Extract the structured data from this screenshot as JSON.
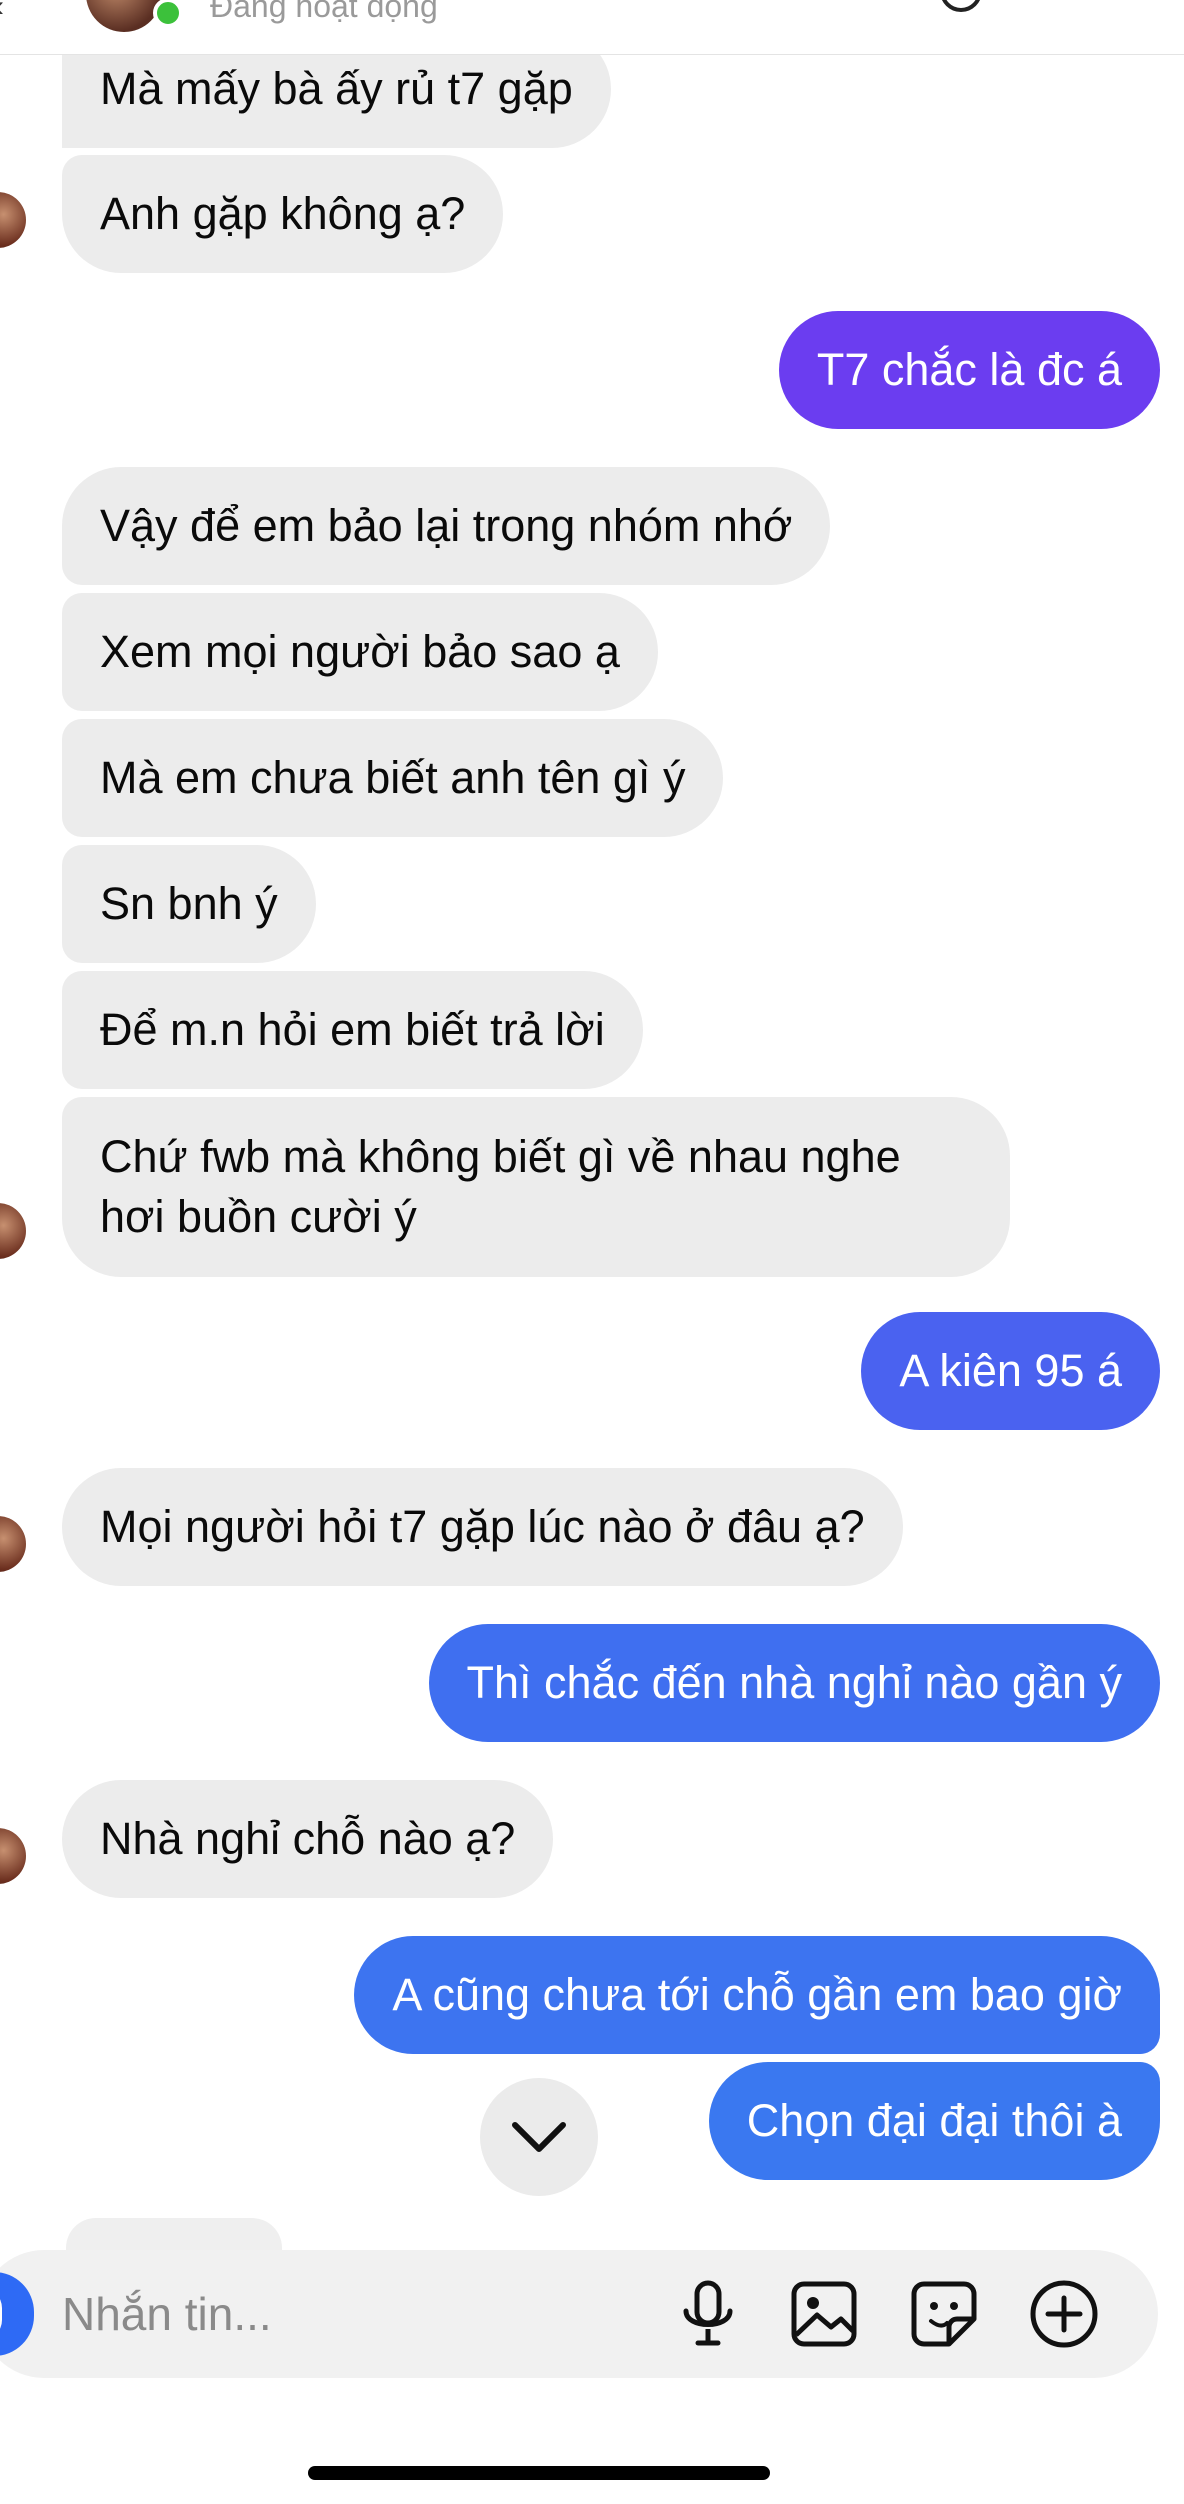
{
  "header": {
    "status": "Đang hoạt động"
  },
  "messages": [
    {
      "side": "in",
      "text": "Mà mấy bà ấy rủ t7 gặp"
    },
    {
      "side": "in",
      "text": "Anh gặp không ạ?"
    },
    {
      "side": "out",
      "text": "T7 chắc là đc á"
    },
    {
      "side": "in",
      "text": "Vậy để em bảo lại trong nhóm nhớ"
    },
    {
      "side": "in",
      "text": "Xem mọi người bảo sao ạ"
    },
    {
      "side": "in",
      "text": "Mà em chưa biết anh tên gì ý"
    },
    {
      "side": "in",
      "text": "Sn bnh ý"
    },
    {
      "side": "in",
      "text": "Để m.n hỏi em biết trả lời"
    },
    {
      "side": "in",
      "text": "Chứ fwb mà không biết gì về nhau nghe hơi buồn cười ý"
    },
    {
      "side": "out",
      "text": "A kiên 95 á"
    },
    {
      "side": "in",
      "text": "Mọi người hỏi t7 gặp lúc nào ở đâu ạ?"
    },
    {
      "side": "out",
      "text": "Thì chắc đến nhà nghỉ nào gần ý"
    },
    {
      "side": "in",
      "text": "Nhà nghỉ chỗ nào ạ?"
    },
    {
      "side": "out",
      "text": "A cũng chưa tới chỗ gần em bao giờ"
    },
    {
      "side": "out",
      "text": "Chọn đại đại thôi à"
    }
  ],
  "composer": {
    "placeholder": "Nhắn tin...",
    "icons": [
      "microphone-icon",
      "image-icon",
      "sticker-icon",
      "plus-icon"
    ]
  },
  "colors": {
    "out_purple": "#6b3df0",
    "out_blue": "#3f6ff0",
    "in_bubble": "#ececec"
  }
}
